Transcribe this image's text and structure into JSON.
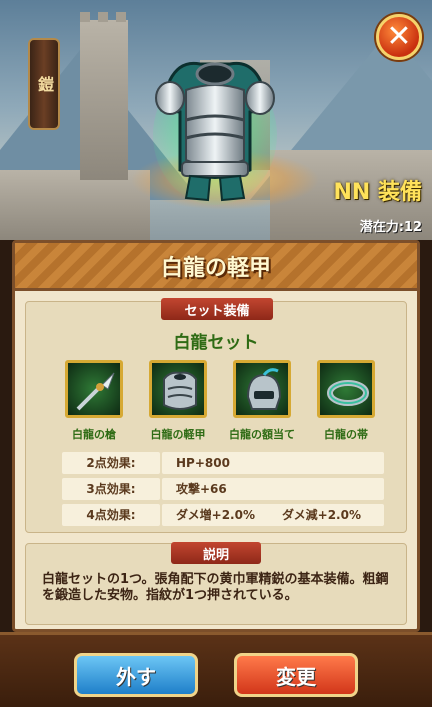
{
  "colors": {
    "rank": "#ffe25a",
    "set_name": "#2e6b14",
    "btn_remove": "#1f7fc9",
    "btn_change": "#d2361a"
  },
  "side_tag": "鎧",
  "rank_label": "NN 装備",
  "potential_label": "潜在力:12",
  "item_title": "白龍の軽甲",
  "set_section": {
    "header": "セット装備",
    "set_name": "白龍セット",
    "items": [
      {
        "label": "白龍の槍",
        "icon": "spear-icon"
      },
      {
        "label": "白龍の軽甲",
        "icon": "armor-icon"
      },
      {
        "label": "白龍の額当て",
        "icon": "helmet-icon"
      },
      {
        "label": "白龍の帯",
        "icon": "belt-icon"
      }
    ],
    "effects": [
      {
        "key": "2点効果:",
        "value": "HP+800",
        "value2": ""
      },
      {
        "key": "3点効果:",
        "value": "攻撃+66",
        "value2": ""
      },
      {
        "key": "4点効果:",
        "value": "ダメ増+2.0%",
        "value2": "ダメ減+2.0%"
      }
    ]
  },
  "description": {
    "header": "説明",
    "text": "白龍セットの1つ。張角配下の黄巾軍精鋭の基本装備。粗鋼を鍛造した安物。指紋が1つ押されている。"
  },
  "buttons": {
    "remove": "外す",
    "change": "変更"
  }
}
